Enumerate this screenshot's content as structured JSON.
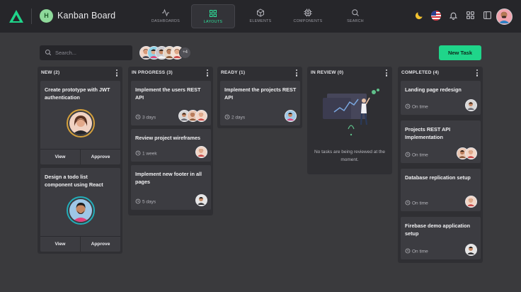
{
  "header": {
    "app_initial": "H",
    "app_title": "Kanban Board",
    "nav": [
      {
        "label": "DASHBOARDS",
        "icon": "activity-icon",
        "active": false
      },
      {
        "label": "LAYOUTS",
        "icon": "grid-icon",
        "active": true
      },
      {
        "label": "ELEMENTS",
        "icon": "cube-icon",
        "active": false
      },
      {
        "label": "COMPONENTS",
        "icon": "cpu-icon",
        "active": false
      },
      {
        "label": "SEARCH",
        "icon": "search-icon",
        "active": false
      }
    ],
    "right_icons": [
      "moon-icon",
      "us-flag-icon",
      "bell-icon",
      "apps-grid-icon",
      "sidebar-toggle-icon",
      "user-avatar"
    ]
  },
  "toolbar": {
    "search_placeholder": "Search...",
    "members_more": "+4",
    "new_task_label": "New Task"
  },
  "columns": [
    {
      "title": "NEW (2)",
      "cards": [
        {
          "title": "Create prototype with JWT authentication",
          "actions": [
            "View",
            "Approve"
          ]
        },
        {
          "title": "Design a todo list component using React",
          "actions": [
            "View",
            "Approve"
          ]
        }
      ]
    },
    {
      "title": "IN PROGRESS (3)",
      "cards": [
        {
          "title": "Implement the users REST API",
          "meta": "3 days"
        },
        {
          "title": "Review project wireframes",
          "meta": "1 week"
        },
        {
          "title": "Implement new footer in all pages",
          "meta": "5 days"
        }
      ]
    },
    {
      "title": "READY (1)",
      "cards": [
        {
          "title": "Implement the projects REST API",
          "meta": "2 days"
        }
      ]
    },
    {
      "title": "IN REVIEW (0)",
      "empty_text": "No tasks are being reviewed at the moment."
    },
    {
      "title": "COMPLETED (4)",
      "cards": [
        {
          "title": "Landing page redesign",
          "meta": "On time"
        },
        {
          "title": "Projects REST API Implementation",
          "meta": "On time"
        },
        {
          "title": "Database replication setup",
          "meta": "On time"
        },
        {
          "title": "Firebase demo application setup",
          "meta": "On time"
        }
      ]
    }
  ],
  "colors": {
    "accent": "#1fd58a",
    "background": "#3a3a3d",
    "topbar": "#26262a",
    "column": "#2f2f33",
    "card": "#3c3c41"
  }
}
